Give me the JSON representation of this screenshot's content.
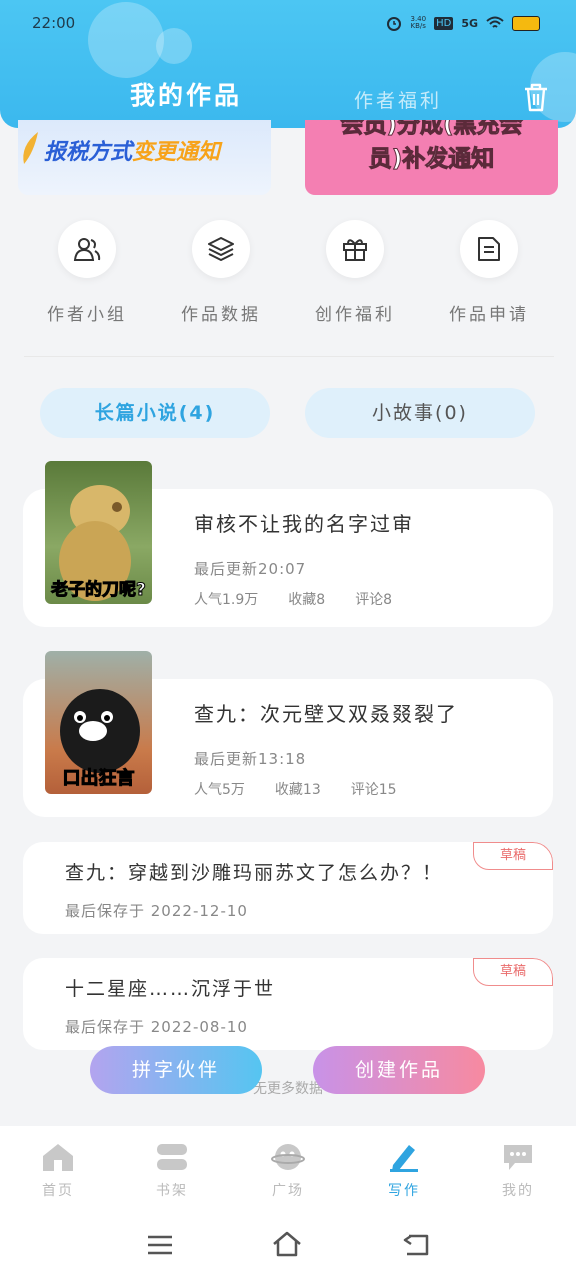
{
  "status": {
    "time": "22:00",
    "net_speed": "3.40\nKB/s",
    "hd": "HD",
    "signal": "5G"
  },
  "header": {
    "tab_active": "我的作品",
    "tab_inactive": "作者福利"
  },
  "banners": [
    {
      "text_a": "报税方式",
      "text_b": "变更通知"
    },
    {
      "line1": "会员)分成(黑充会",
      "line2": "员)补发通知"
    }
  ],
  "shortcuts": [
    {
      "label": "作者小组",
      "icon": "people-icon"
    },
    {
      "label": "作品数据",
      "icon": "layers-icon"
    },
    {
      "label": "创作福利",
      "icon": "gift-icon"
    },
    {
      "label": "作品申请",
      "icon": "document-icon"
    }
  ],
  "categories": [
    {
      "label": "长篇小说(4)"
    },
    {
      "label": "小故事(0)"
    }
  ],
  "works": [
    {
      "title": "审核不让我的名字过审",
      "updated": "最后更新20:07",
      "popularity": "人气1.9万",
      "favorites": "收藏8",
      "comments": "评论8",
      "cover_caption": "老子的刀呢?"
    },
    {
      "title": "查九：次元壁又双叒叕裂了",
      "updated": "最后更新13:18",
      "popularity": "人气5万",
      "favorites": "收藏13",
      "comments": "评论15",
      "cover_caption": "口出狂言"
    }
  ],
  "drafts": [
    {
      "title": "查九：穿越到沙雕玛丽苏文了怎么办？！",
      "saved": "最后保存于 2022-12-10",
      "badge": "草稿"
    },
    {
      "title": "十二星座……沉浮于世",
      "saved": "最后保存于 2022-08-10",
      "badge": "草稿"
    }
  ],
  "more_text": "无更多数据",
  "fab": {
    "left": "拼字伙伴",
    "right": "创建作品"
  },
  "nav": [
    {
      "label": "首页",
      "icon": "home-icon"
    },
    {
      "label": "书架",
      "icon": "bookshelf-icon"
    },
    {
      "label": "广场",
      "icon": "planet-icon"
    },
    {
      "label": "写作",
      "icon": "pen-icon",
      "active": true
    },
    {
      "label": "我的",
      "icon": "chat-icon"
    }
  ],
  "colors": {
    "accent": "#2fa4e0",
    "header": "#3bb8ee",
    "draft_badge": "#e96b6b"
  }
}
